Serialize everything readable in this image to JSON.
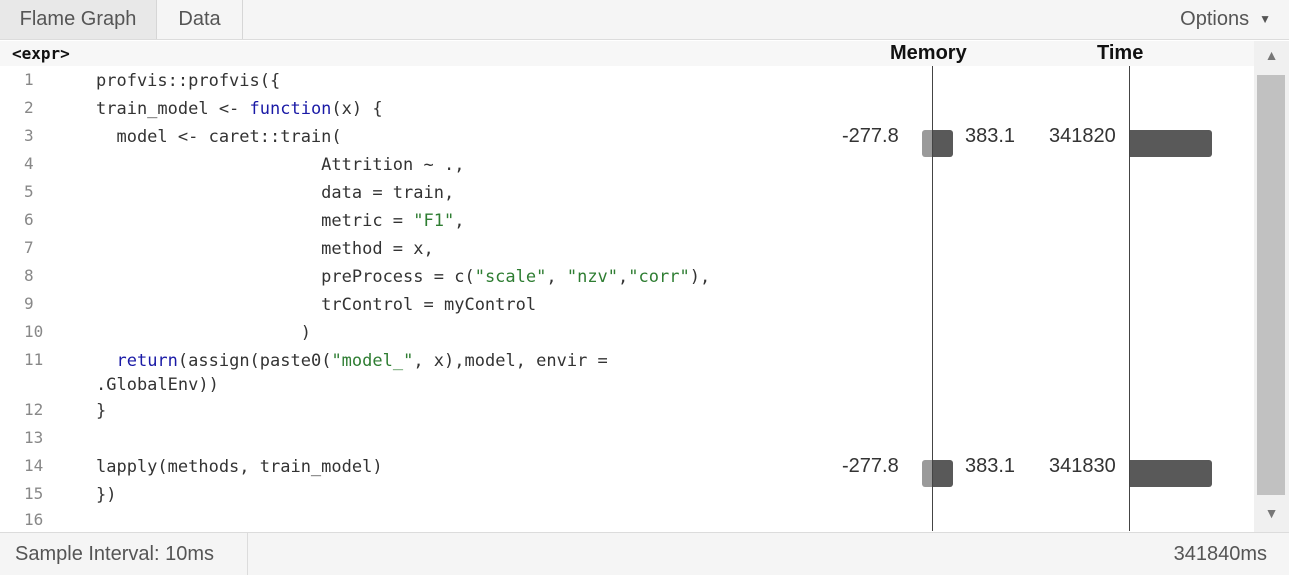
{
  "tabs": {
    "flame": "Flame Graph",
    "data": "Data"
  },
  "options": {
    "label": "Options",
    "caret": "▼"
  },
  "header": {
    "expr": "<expr>",
    "memory": "Memory",
    "time": "Time"
  },
  "lines": [
    {
      "n": "1",
      "html": "profvis::profvis({"
    },
    {
      "n": "2",
      "html": "train_model <- <span class=\"kw\">function</span>(x) {"
    },
    {
      "n": "3",
      "html": "  model <- caret::train("
    },
    {
      "n": "4",
      "html": "                      Attrition ~ .,"
    },
    {
      "n": "5",
      "html": "                      data = train,"
    },
    {
      "n": "6",
      "html": "                      metric = <span class=\"str\">\"F1\"</span>,"
    },
    {
      "n": "7",
      "html": "                      method = x,"
    },
    {
      "n": "8",
      "html": "                      preProcess = c(<span class=\"str\">\"scale\"</span>, <span class=\"str\">\"nzv\"</span>,<span class=\"str\">\"corr\"</span>),"
    },
    {
      "n": "9",
      "html": "                      trControl = myControl"
    },
    {
      "n": "10",
      "html": "                    )"
    },
    {
      "n": "11",
      "html": "  <span class=\"kw\">return</span>(assign(paste0(<span class=\"str\">\"model_\"</span>, x),model, envir =\n.GlobalEnv))"
    },
    {
      "n": "12",
      "html": "}"
    },
    {
      "n": "13",
      "html": ""
    },
    {
      "n": "14",
      "html": "lapply(methods, train_model)"
    },
    {
      "n": "15",
      "html": "})"
    },
    {
      "n": "16",
      "html": ""
    }
  ],
  "metrics": {
    "line3": {
      "mem_neg": "-277.8",
      "mem_pos": "383.1",
      "time": "341820"
    },
    "line14": {
      "mem_neg": "-277.8",
      "mem_pos": "383.1",
      "time": "341830"
    }
  },
  "status": {
    "interval": "Sample Interval: 10ms",
    "total": "341840ms"
  }
}
